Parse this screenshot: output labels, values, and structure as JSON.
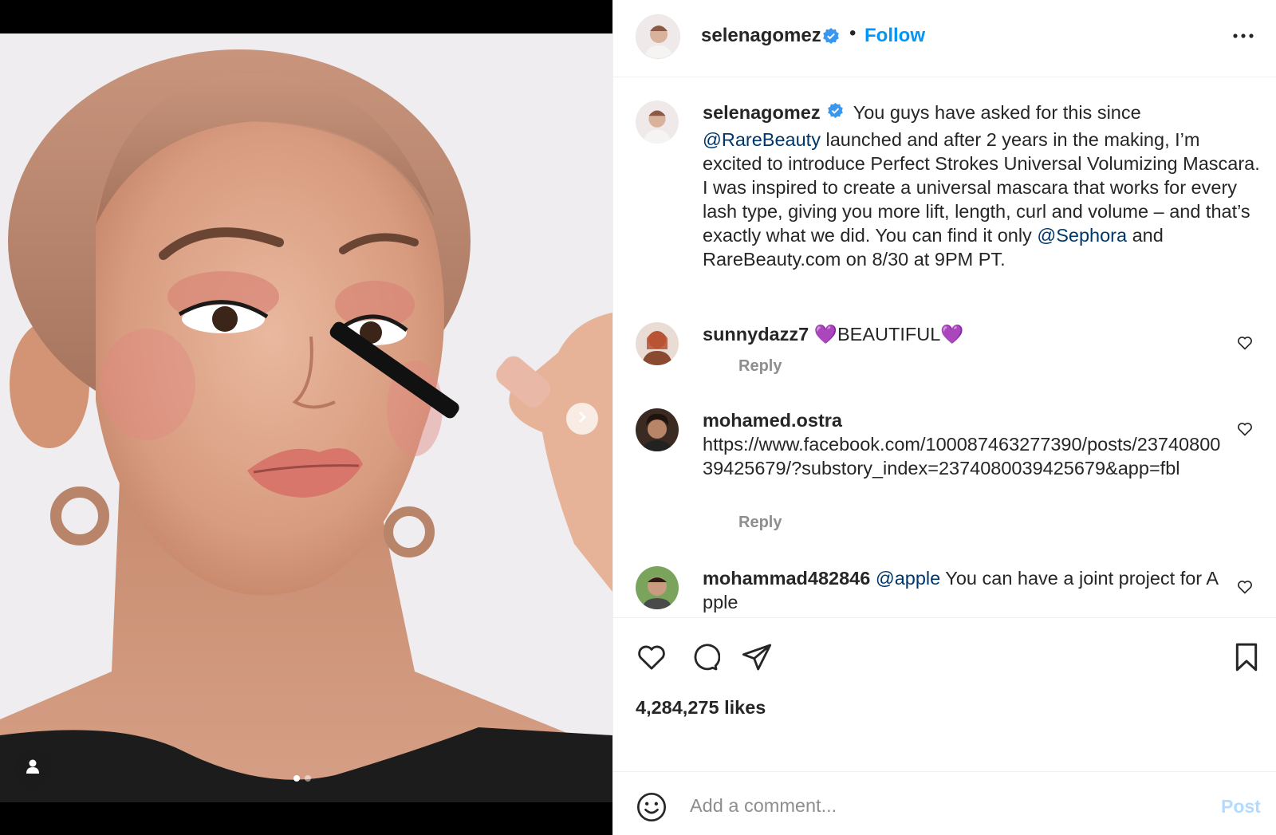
{
  "post": {
    "username": "selenagomez",
    "separator": "•",
    "follow_label": "Follow",
    "more_icon": "more-options-icon"
  },
  "caption": {
    "username": "selenagomez",
    "t1": " You guys have asked for this since ",
    "m1": "@RareBeauty",
    "t2": " launched and after 2 years in the making, I’m excited to introduce Perfect Strokes Universal Volumizing Mascara. I was inspired to create a universal mascara that works for every lash type, giving you more lift, length, curl and volume – and that’s exactly what we did. You can find it only ",
    "m2": "@Sephora",
    "t3": " and RareBeauty.com on 8/30 at 9PM PT."
  },
  "comments": [
    {
      "username": "sunnydazz7",
      "text": "💜BEAUTIFUL💜",
      "reply_label": "Reply"
    },
    {
      "username": "mohamed.ostra",
      "text": "https://www.facebook.com/100087463277390/posts/2374080039425679/?substory_index=2374080039425679&app=fbl",
      "reply_label": "Reply"
    },
    {
      "username": "mohammad482846",
      "mention": "@apple",
      "text": " You can have a joint project for Apple"
    }
  ],
  "likes": "4,284,275 likes",
  "composer": {
    "placeholder": "Add a comment...",
    "post_label": "Post"
  },
  "carousel": {
    "current": 1,
    "total": 2
  },
  "colors": {
    "link_blue": "#0095f6",
    "mention": "#00376b",
    "secondary_text": "#8e8e8e",
    "post_disabled": "#b3dbff",
    "verified": "#3897f0"
  }
}
